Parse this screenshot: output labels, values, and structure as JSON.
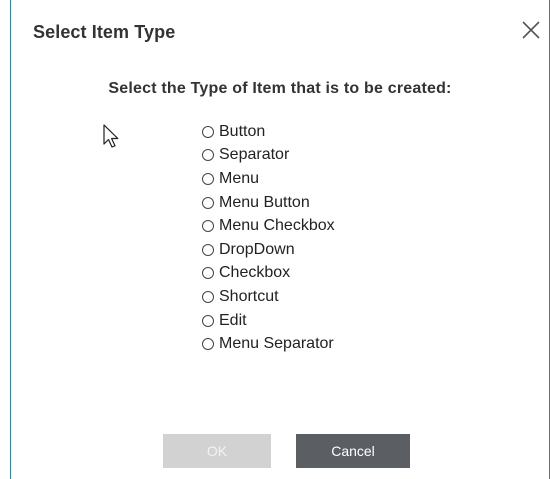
{
  "dialog": {
    "title": "Select Item Type",
    "close_icon": "close-icon",
    "instruction": "Select the Type of Item that is to be created:",
    "options": [
      {
        "label": "Button",
        "selected": false
      },
      {
        "label": "Separator",
        "selected": false
      },
      {
        "label": "Menu",
        "selected": false
      },
      {
        "label": "Menu Button",
        "selected": false
      },
      {
        "label": "Menu Checkbox",
        "selected": false
      },
      {
        "label": "DropDown",
        "selected": false
      },
      {
        "label": "Checkbox",
        "selected": false
      },
      {
        "label": "Shortcut",
        "selected": false
      },
      {
        "label": "Edit",
        "selected": false
      },
      {
        "label": "Menu Separator",
        "selected": false
      }
    ],
    "ok_label": "OK",
    "cancel_label": "Cancel"
  },
  "colors": {
    "border": "#2f7fc7",
    "ok_disabled_bg": "#d2d2d2",
    "cancel_bg": "#5b5f63"
  }
}
